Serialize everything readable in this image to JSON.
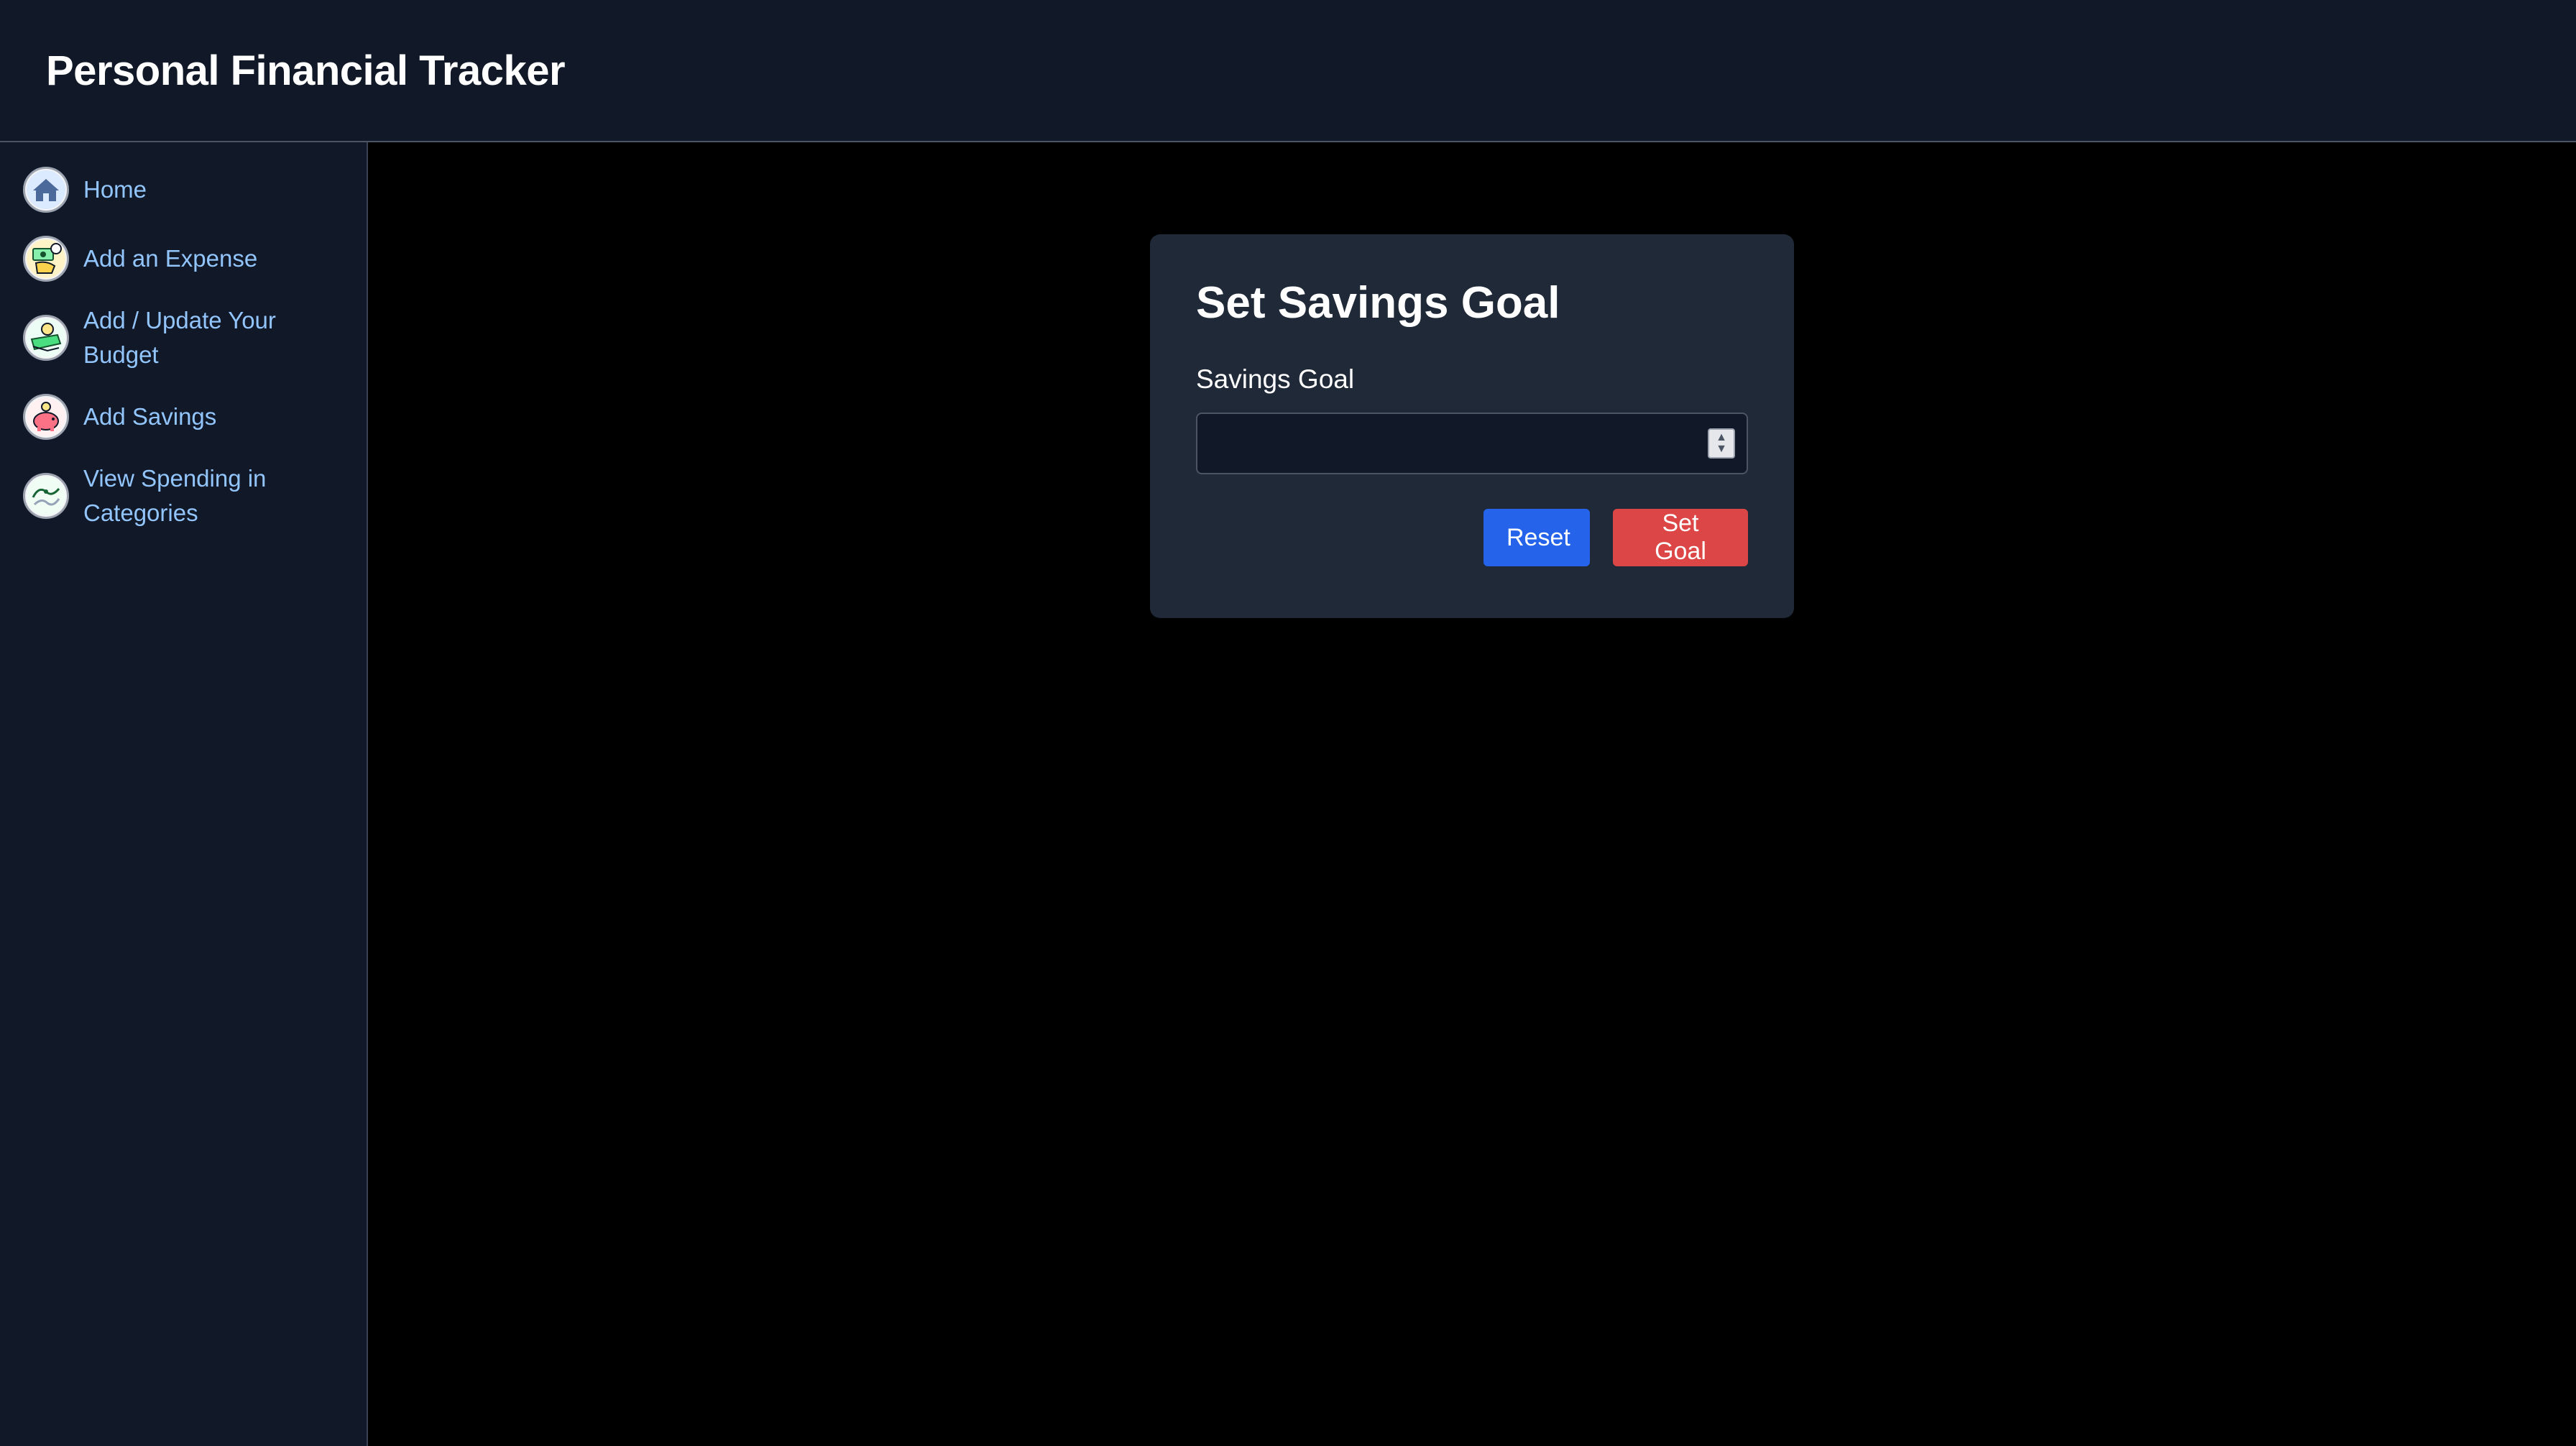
{
  "header": {
    "title": "Personal Financial Tracker"
  },
  "sidebar": {
    "items": [
      {
        "label": "Home",
        "icon": "house-icon"
      },
      {
        "label": "Add an Expense",
        "icon": "money-hand-icon"
      },
      {
        "label": "Add / Update Your Budget",
        "icon": "budget-cash-icon"
      },
      {
        "label": "Add Savings",
        "icon": "piggy-bank-icon"
      },
      {
        "label": "View Spending in Categories",
        "icon": "categories-chart-icon"
      }
    ]
  },
  "form": {
    "title": "Set Savings Goal",
    "field_label": "Savings Goal",
    "field_value": "",
    "reset_label": "Reset",
    "submit_label": "Set Goal"
  },
  "colors": {
    "header_bg": "#111827",
    "card_bg": "#1f2937",
    "link": "#93c5fd",
    "reset_button": "#2563eb",
    "submit_button": "#dc4646"
  }
}
